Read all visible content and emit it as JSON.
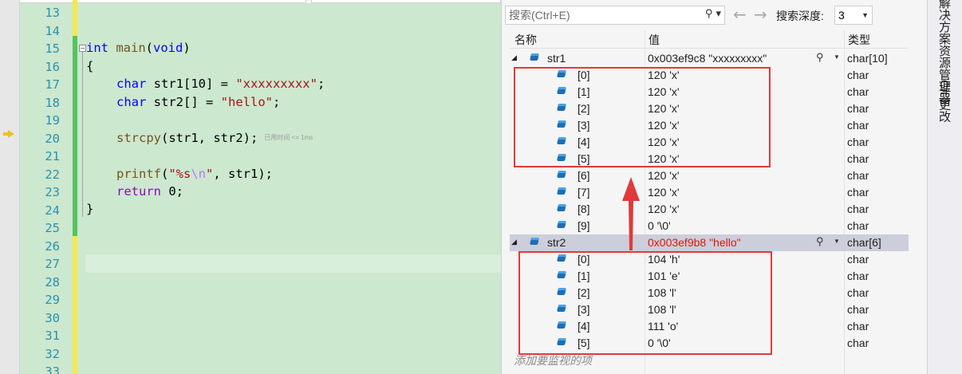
{
  "editor": {
    "line_numbers": [
      "13",
      "14",
      "15",
      "16",
      "17",
      "18",
      "19",
      "20",
      "21",
      "22",
      "23",
      "24",
      "25",
      "26",
      "27",
      "28",
      "29",
      "30",
      "31",
      "32",
      "33"
    ],
    "code": {
      "l15_kw1": "int",
      "l15_fn": "main",
      "l15_paren_open": "(",
      "l15_kw2": "void",
      "l15_paren_close": ")",
      "l16": "{",
      "l17_kw": "char",
      "l17_rest": " str1[10] = ",
      "l17_str": "\"xxxxxxxxx\"",
      "l17_end": ";",
      "l18_kw": "char",
      "l18_rest": " str2[] = ",
      "l18_str": "\"hello\"",
      "l18_end": ";",
      "l20_fn": "strcpy",
      "l20_rest": "(str1, str2);",
      "l20_elapsed": "已用时间 <= 1ms",
      "l22_fn": "printf",
      "l22_open": "(",
      "l22_str1": "\"%s",
      "l22_esc": "\\n",
      "l22_str2": "\"",
      "l22_rest": ", str1);",
      "l23_kw": "return",
      "l23_rest": " 0;",
      "l24": "}"
    }
  },
  "watch": {
    "search_placeholder": "搜索(Ctrl+E)",
    "search_icon": "magnifier-icon",
    "depth_label": "搜索深度:",
    "depth_value": "3",
    "columns": {
      "name": "名称",
      "value": "值",
      "type": "类型"
    },
    "rows": [
      {
        "name": "str1",
        "value": "0x003ef9c8 \"xxxxxxxxx\"",
        "type": "char[10]",
        "level": 0
      },
      {
        "name": "[0]",
        "value": "120 'x'",
        "type": "char",
        "level": 1
      },
      {
        "name": "[1]",
        "value": "120 'x'",
        "type": "char",
        "level": 1
      },
      {
        "name": "[2]",
        "value": "120 'x'",
        "type": "char",
        "level": 1
      },
      {
        "name": "[3]",
        "value": "120 'x'",
        "type": "char",
        "level": 1
      },
      {
        "name": "[4]",
        "value": "120 'x'",
        "type": "char",
        "level": 1
      },
      {
        "name": "[5]",
        "value": "120 'x'",
        "type": "char",
        "level": 1
      },
      {
        "name": "[6]",
        "value": "120 'x'",
        "type": "char",
        "level": 1
      },
      {
        "name": "[7]",
        "value": "120 'x'",
        "type": "char",
        "level": 1
      },
      {
        "name": "[8]",
        "value": "120 'x'",
        "type": "char",
        "level": 1
      },
      {
        "name": "[9]",
        "value": "0 '\\0'",
        "type": "char",
        "level": 1
      },
      {
        "name": "str2",
        "value": "0x003ef9b8 \"hello\"",
        "type": "char[6]",
        "level": 0
      },
      {
        "name": "[0]",
        "value": "104 'h'",
        "type": "char",
        "level": 1
      },
      {
        "name": "[1]",
        "value": "101 'e'",
        "type": "char",
        "level": 1
      },
      {
        "name": "[2]",
        "value": "108 'l'",
        "type": "char",
        "level": 1
      },
      {
        "name": "[3]",
        "value": "108 'l'",
        "type": "char",
        "level": 1
      },
      {
        "name": "[4]",
        "value": "111 'o'",
        "type": "char",
        "level": 1
      },
      {
        "name": "[5]",
        "value": "0 '\\0'",
        "type": "char",
        "level": 1
      }
    ],
    "add_watch": "添加要监视的项"
  },
  "side_tabs": [
    "解决方案资源管理器",
    "Git 更改"
  ],
  "colors": {
    "editor_bg": "#cce8cf",
    "changed_value": "#e51400",
    "annotation_red": "#e03a3a",
    "selected_row": "#cccedb"
  }
}
